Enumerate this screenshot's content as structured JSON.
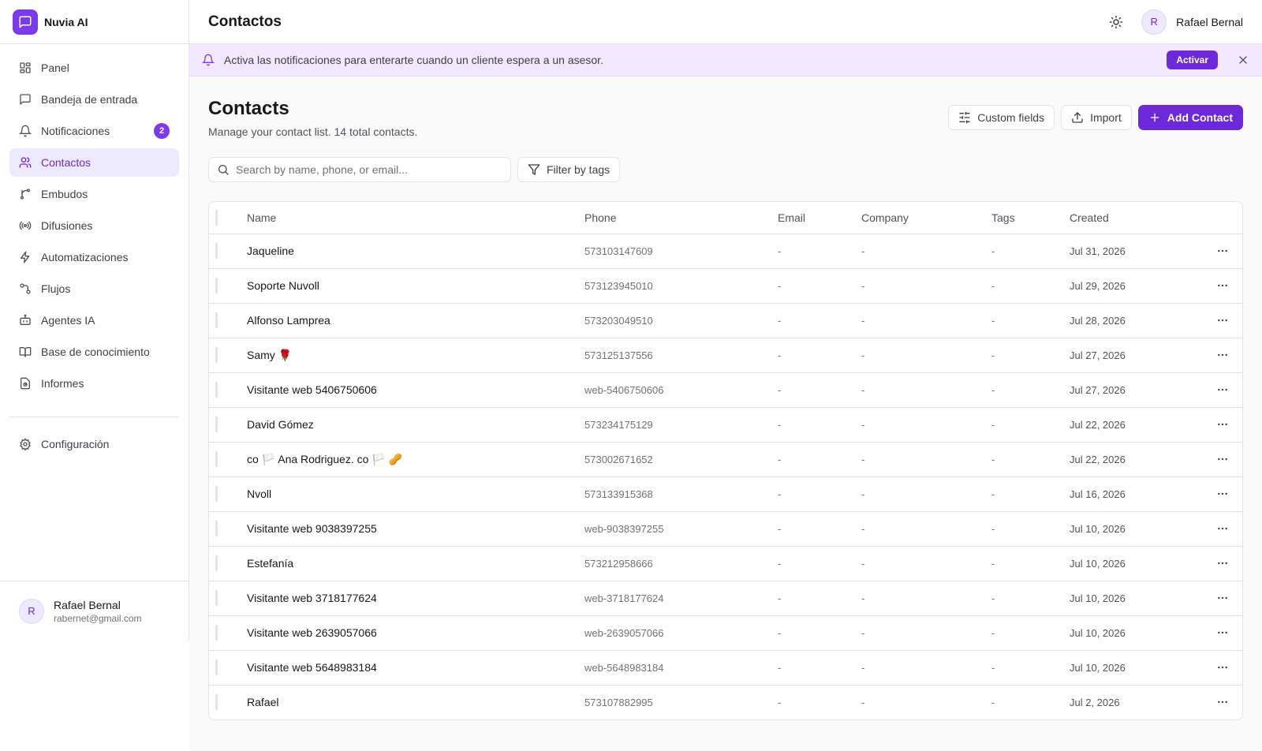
{
  "brand": {
    "name": "Nuvia AI"
  },
  "sidebar": {
    "items": [
      {
        "label": "Panel",
        "icon": "dashboard-icon"
      },
      {
        "label": "Bandeja de entrada",
        "icon": "inbox-icon"
      },
      {
        "label": "Notificaciones",
        "icon": "bell-icon",
        "badge": "2"
      },
      {
        "label": "Contactos",
        "icon": "users-icon",
        "active": true
      },
      {
        "label": "Embudos",
        "icon": "funnel-icon"
      },
      {
        "label": "Difusiones",
        "icon": "broadcast-icon"
      },
      {
        "label": "Automatizaciones",
        "icon": "zap-icon"
      },
      {
        "label": "Flujos",
        "icon": "flow-icon"
      },
      {
        "label": "Agentes IA",
        "icon": "bot-icon"
      },
      {
        "label": "Base de conocimiento",
        "icon": "book-icon"
      },
      {
        "label": "Informes",
        "icon": "reports-icon"
      }
    ],
    "settings": {
      "label": "Configuración",
      "icon": "gear-icon"
    },
    "user": {
      "initial": "R",
      "name": "Rafael Bernal",
      "email": "rabernet@gmail.com"
    }
  },
  "topbar": {
    "title": "Contactos",
    "user": {
      "initial": "R",
      "name": "Rafael Bernal"
    }
  },
  "banner": {
    "text": "Activa las notificaciones para enterarte cuando un cliente espera a un asesor.",
    "action_label": "Activar"
  },
  "page": {
    "title": "Contacts",
    "subtitle": "Manage your contact list. 14 total contacts.",
    "actions": {
      "custom_fields": "Custom fields",
      "import": "Import",
      "add_contact": "Add Contact"
    }
  },
  "search": {
    "placeholder": "Search by name, phone, or email...",
    "value": ""
  },
  "filter": {
    "label": "Filter by tags"
  },
  "table": {
    "columns": {
      "name": "Name",
      "phone": "Phone",
      "email": "Email",
      "company": "Company",
      "tags": "Tags",
      "created": "Created"
    },
    "rows": [
      {
        "name": "Jaqueline",
        "phone": "573103147609",
        "email": "-",
        "company": "-",
        "tags": "-",
        "created": "Jul 31, 2026"
      },
      {
        "name": "Soporte Nuvoll",
        "phone": "573123945010",
        "email": "-",
        "company": "-",
        "tags": "-",
        "created": "Jul 29, 2026"
      },
      {
        "name": "Alfonso Lamprea",
        "phone": "573203049510",
        "email": "-",
        "company": "-",
        "tags": "-",
        "created": "Jul 28, 2026"
      },
      {
        "name": "Samy 🌹",
        "phone": "573125137556",
        "email": "-",
        "company": "-",
        "tags": "-",
        "created": "Jul 27, 2026"
      },
      {
        "name": "Visitante web 5406750606",
        "phone": "web-5406750606",
        "email": "-",
        "company": "-",
        "tags": "-",
        "created": "Jul 27, 2026"
      },
      {
        "name": "David Gómez",
        "phone": "573234175129",
        "email": "-",
        "company": "-",
        "tags": "-",
        "created": "Jul 22, 2026"
      },
      {
        "name": "co 🏳️ Ana Rodriguez. co 🏳️ 🥜",
        "phone": "573002671652",
        "email": "-",
        "company": "-",
        "tags": "-",
        "created": "Jul 22, 2026"
      },
      {
        "name": "Nvoll",
        "phone": "573133915368",
        "email": "-",
        "company": "-",
        "tags": "-",
        "created": "Jul 16, 2026"
      },
      {
        "name": "Visitante web 9038397255",
        "phone": "web-9038397255",
        "email": "-",
        "company": "-",
        "tags": "-",
        "created": "Jul 10, 2026"
      },
      {
        "name": "Estefanía",
        "phone": "573212958666",
        "email": "-",
        "company": "-",
        "tags": "-",
        "created": "Jul 10, 2026"
      },
      {
        "name": "Visitante web 3718177624",
        "phone": "web-3718177624",
        "email": "-",
        "company": "-",
        "tags": "-",
        "created": "Jul 10, 2026"
      },
      {
        "name": "Visitante web 2639057066",
        "phone": "web-2639057066",
        "email": "-",
        "company": "-",
        "tags": "-",
        "created": "Jul 10, 2026"
      },
      {
        "name": "Visitante web 5648983184",
        "phone": "web-5648983184",
        "email": "-",
        "company": "-",
        "tags": "-",
        "created": "Jul 10, 2026"
      },
      {
        "name": "Rafael",
        "phone": "573107882995",
        "email": "-",
        "company": "-",
        "tags": "-",
        "created": "Jul 2, 2026"
      }
    ]
  },
  "colors": {
    "accent": "#6d28d9",
    "accent_soft": "#ede9fe",
    "banner_bg": "#f3e8ff"
  }
}
